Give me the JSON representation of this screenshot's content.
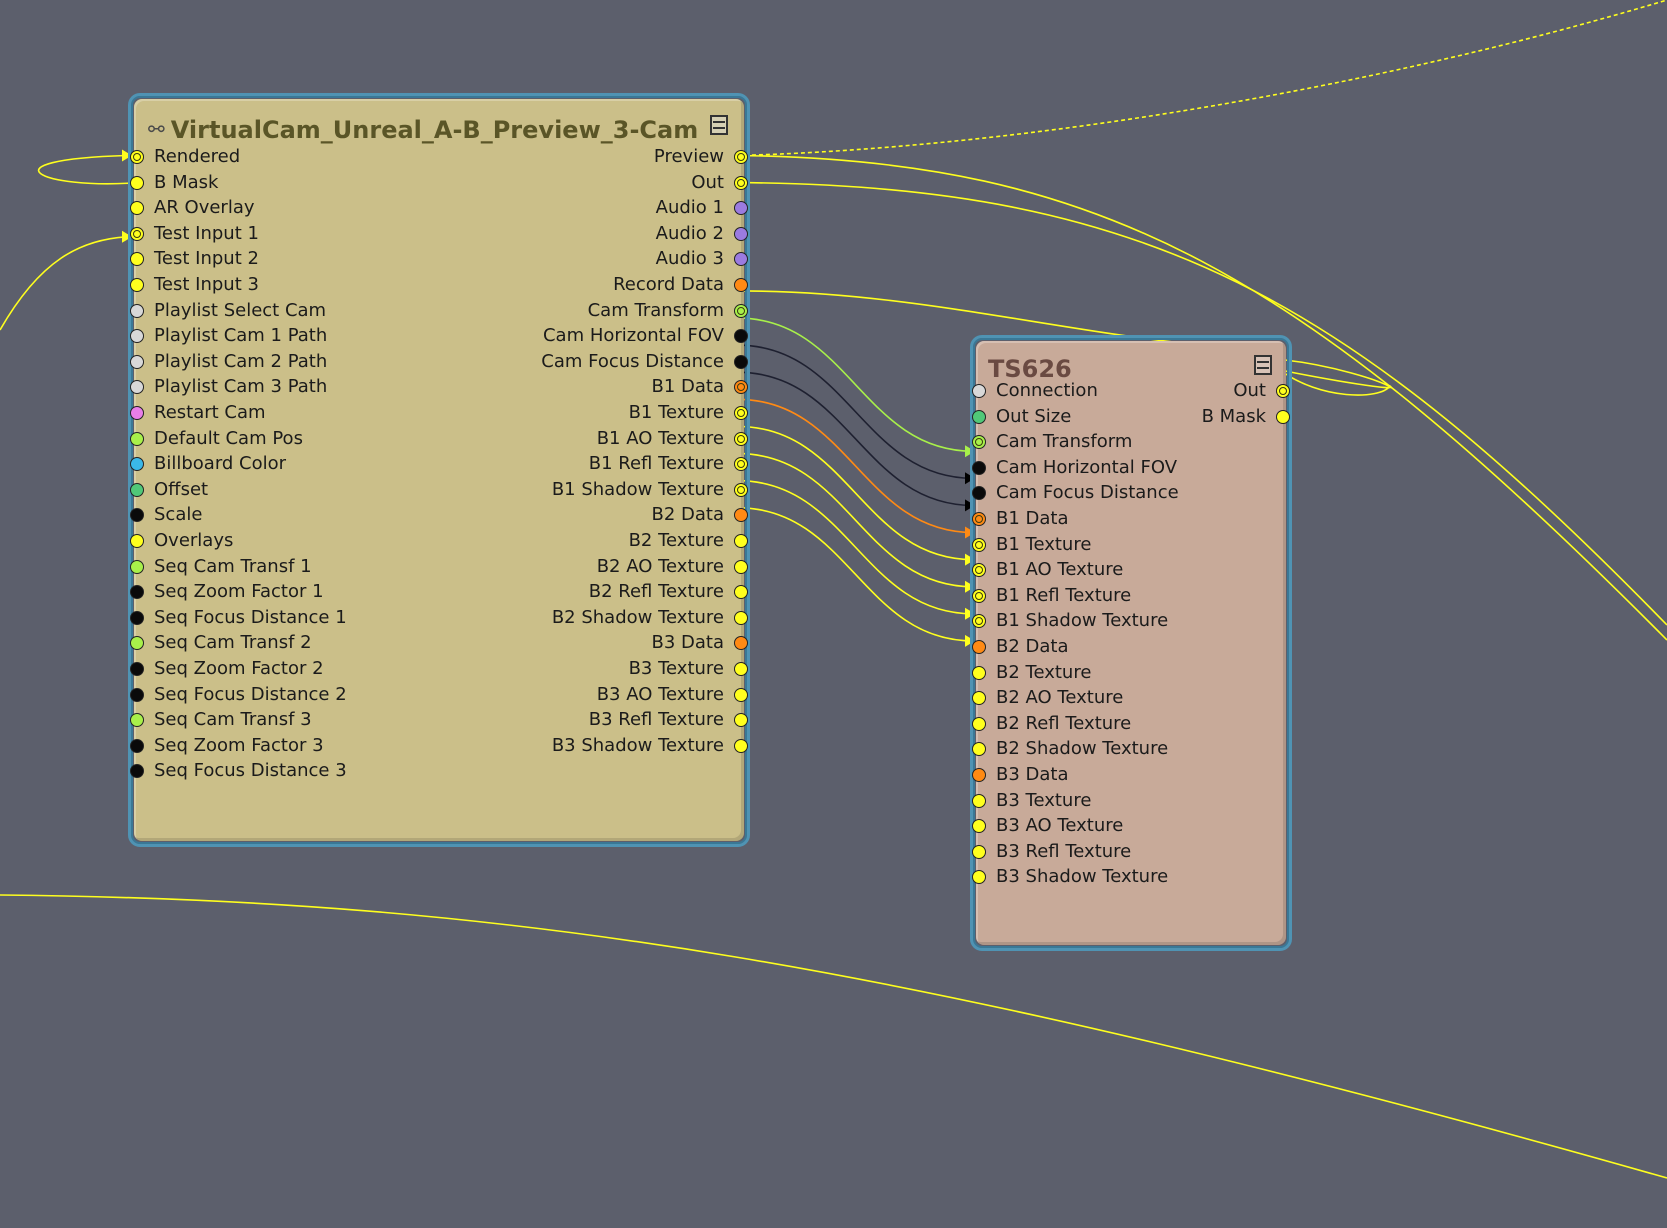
{
  "colors": {
    "yellow": "#ffff1e",
    "yellowgreen": "#a8f04a",
    "green": "#50c878",
    "black": "#0a0a0a",
    "white": "#d8d8d8",
    "orange": "#ff8a14",
    "purple": "#9b7be0",
    "magenta": "#e87ee8",
    "cyan": "#3ab8e8"
  },
  "nodes": {
    "virtualcam": {
      "title": "VirtualCam_Unreal_A-B_Preview_3-Cam",
      "icon": "link-icon",
      "inputs": [
        {
          "label": "Rendered",
          "color": "yellow",
          "connected": true
        },
        {
          "label": "B Mask",
          "color": "yellow",
          "connected": false
        },
        {
          "label": "AR Overlay",
          "color": "yellow",
          "connected": false
        },
        {
          "label": "Test Input 1",
          "color": "yellow",
          "connected": true
        },
        {
          "label": "Test Input 2",
          "color": "yellow",
          "connected": false
        },
        {
          "label": "Test Input 3",
          "color": "yellow",
          "connected": false
        },
        {
          "label": "Playlist Select Cam",
          "color": "white",
          "connected": false
        },
        {
          "label": "Playlist Cam 1 Path",
          "color": "white",
          "connected": false
        },
        {
          "label": "Playlist Cam 2 Path",
          "color": "white",
          "connected": false
        },
        {
          "label": "Playlist Cam 3 Path",
          "color": "white",
          "connected": false
        },
        {
          "label": "Restart Cam",
          "color": "magenta",
          "connected": false
        },
        {
          "label": "Default Cam Pos",
          "color": "yellowgreen",
          "connected": false
        },
        {
          "label": "Billboard Color",
          "color": "cyan",
          "connected": false
        },
        {
          "label": "Offset",
          "color": "green",
          "connected": false
        },
        {
          "label": "Scale",
          "color": "black",
          "connected": false
        },
        {
          "label": "Overlays",
          "color": "yellow",
          "connected": false
        },
        {
          "label": "Seq Cam Transf 1",
          "color": "yellowgreen",
          "connected": false
        },
        {
          "label": "Seq Zoom Factor 1",
          "color": "black",
          "connected": false
        },
        {
          "label": "Seq Focus Distance 1",
          "color": "black",
          "connected": false
        },
        {
          "label": "Seq Cam Transf 2",
          "color": "yellowgreen",
          "connected": false
        },
        {
          "label": "Seq Zoom Factor 2",
          "color": "black",
          "connected": false
        },
        {
          "label": "Seq Focus Distance 2",
          "color": "black",
          "connected": false
        },
        {
          "label": "Seq Cam Transf 3",
          "color": "yellowgreen",
          "connected": false
        },
        {
          "label": "Seq Zoom Factor 3",
          "color": "black",
          "connected": false
        },
        {
          "label": "Seq Focus Distance 3",
          "color": "black",
          "connected": false
        }
      ],
      "outputs": [
        {
          "label": "Preview",
          "color": "yellow",
          "connected": true
        },
        {
          "label": "Out",
          "color": "yellow",
          "connected": true
        },
        {
          "label": "Audio 1",
          "color": "purple",
          "connected": false
        },
        {
          "label": "Audio 2",
          "color": "purple",
          "connected": false
        },
        {
          "label": "Audio 3",
          "color": "purple",
          "connected": false
        },
        {
          "label": "Record Data",
          "color": "orange",
          "connected": false
        },
        {
          "label": "Cam Transform",
          "color": "yellowgreen",
          "connected": true
        },
        {
          "label": "Cam Horizontal FOV",
          "color": "black",
          "connected": false
        },
        {
          "label": "Cam Focus Distance",
          "color": "black",
          "connected": false
        },
        {
          "label": "B1 Data",
          "color": "orange",
          "connected": true
        },
        {
          "label": "B1 Texture",
          "color": "yellow",
          "connected": true
        },
        {
          "label": "B1 AO Texture",
          "color": "yellow",
          "connected": true
        },
        {
          "label": "B1 Refl Texture",
          "color": "yellow",
          "connected": true
        },
        {
          "label": "B1 Shadow Texture",
          "color": "yellow",
          "connected": true
        },
        {
          "label": "B2 Data",
          "color": "orange",
          "connected": false
        },
        {
          "label": "B2 Texture",
          "color": "yellow",
          "connected": false
        },
        {
          "label": "B2 AO Texture",
          "color": "yellow",
          "connected": false
        },
        {
          "label": "B2 Refl Texture",
          "color": "yellow",
          "connected": false
        },
        {
          "label": "B2 Shadow Texture",
          "color": "yellow",
          "connected": false
        },
        {
          "label": "B3 Data",
          "color": "orange",
          "connected": false
        },
        {
          "label": "B3 Texture",
          "color": "yellow",
          "connected": false
        },
        {
          "label": "B3 AO Texture",
          "color": "yellow",
          "connected": false
        },
        {
          "label": "B3 Refl Texture",
          "color": "yellow",
          "connected": false
        },
        {
          "label": "B3 Shadow Texture",
          "color": "yellow",
          "connected": false
        }
      ]
    },
    "ts626": {
      "title": "TS626",
      "inputs": [
        {
          "label": "Connection",
          "color": "white",
          "connected": false
        },
        {
          "label": "Out Size",
          "color": "green",
          "connected": false
        },
        {
          "label": "Cam Transform",
          "color": "yellowgreen",
          "connected": true
        },
        {
          "label": "Cam Horizontal FOV",
          "color": "black",
          "connected": false
        },
        {
          "label": "Cam Focus Distance",
          "color": "black",
          "connected": false
        },
        {
          "label": "B1 Data",
          "color": "orange",
          "connected": true
        },
        {
          "label": "B1 Texture",
          "color": "yellow",
          "connected": true
        },
        {
          "label": "B1 AO Texture",
          "color": "yellow",
          "connected": true
        },
        {
          "label": "B1 Refl Texture",
          "color": "yellow",
          "connected": true
        },
        {
          "label": "B1 Shadow Texture",
          "color": "yellow",
          "connected": true
        },
        {
          "label": "B2 Data",
          "color": "orange",
          "connected": false
        },
        {
          "label": "B2 Texture",
          "color": "yellow",
          "connected": false
        },
        {
          "label": "B2 AO Texture",
          "color": "yellow",
          "connected": false
        },
        {
          "label": "B2 Refl Texture",
          "color": "yellow",
          "connected": false
        },
        {
          "label": "B2 Shadow Texture",
          "color": "yellow",
          "connected": false
        },
        {
          "label": "B3 Data",
          "color": "orange",
          "connected": false
        },
        {
          "label": "B3 Texture",
          "color": "yellow",
          "connected": false
        },
        {
          "label": "B3 AO Texture",
          "color": "yellow",
          "connected": false
        },
        {
          "label": "B3 Refl Texture",
          "color": "yellow",
          "connected": false
        },
        {
          "label": "B3 Shadow Texture",
          "color": "yellow",
          "connected": false
        }
      ],
      "outputs": [
        {
          "label": "Out",
          "color": "yellow",
          "connected": true
        },
        {
          "label": "B Mask",
          "color": "yellow",
          "connected": false
        }
      ]
    }
  }
}
